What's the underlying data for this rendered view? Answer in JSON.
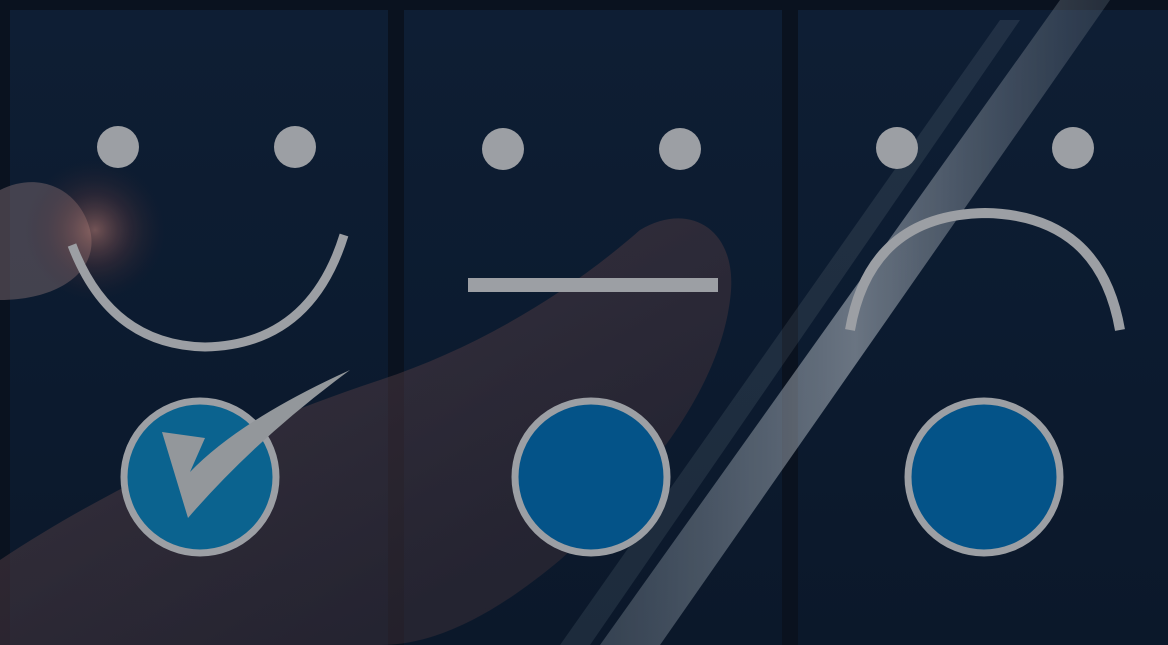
{
  "rating": {
    "options": [
      {
        "sentiment": "happy",
        "face_icon": "smiley-face-icon",
        "selected": true
      },
      {
        "sentiment": "neutral",
        "face_icon": "neutral-face-icon",
        "selected": false
      },
      {
        "sentiment": "sad",
        "face_icon": "sad-face-icon",
        "selected": false
      }
    ],
    "selected_index": 0,
    "selected_icon": "checkmark-icon"
  },
  "colors": {
    "background": "#0a1320",
    "panel": "#0f2035",
    "face_stroke": "#a9acb0",
    "button_fill": "#045a92",
    "button_fill_selected": "#0b6b9a",
    "button_ring": "#a9acb0",
    "check": "#9fa3a7"
  }
}
